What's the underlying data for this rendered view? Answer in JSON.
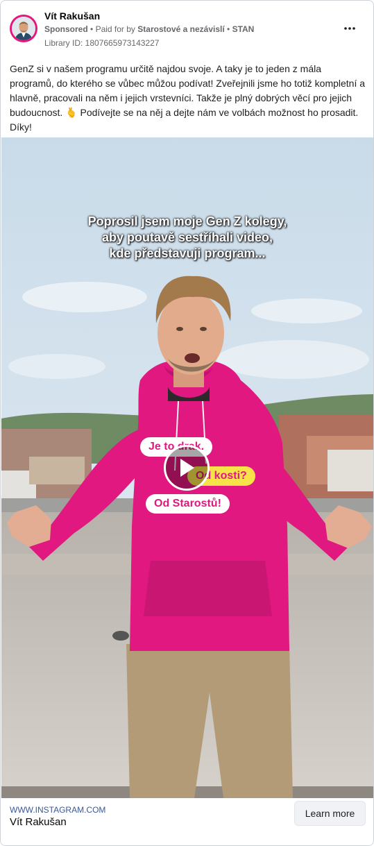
{
  "ad": {
    "advertiser_name": "Vít Rakušan",
    "sponsored_label": "Sponsored",
    "paid_for_prefix": "Paid for by",
    "paid_for_entity": "Starostové a nezávislí",
    "party_abbrev": "STAN",
    "library_id": "Library ID: 1807665973143227",
    "more_options_icon": "more-horizontal-icon",
    "body_text_part1": "GenZ si v našem programu určitě najdou svoje. A taky je to jeden z mála programů, do kterého se vůbec můžou podívat! Zveřejnili jsme ho totiž kompletní a hlavně, pracovali na něm i jejich vrstevníci. Takže je plný dobrých věcí pro jejich budoucnost.",
    "body_emoji": "🫰",
    "body_text_part2": "Podívejte se na něj a dejte nám ve volbách možnost ho prosadit. Díky!"
  },
  "media": {
    "caption_lines": [
      "Poprosil jsem moje Gen Z kolegy,",
      "aby poutavě sestříhali video,",
      "kde představuji program..."
    ],
    "hoodie_texts": [
      "Je to drak.",
      "Od kosti?",
      "Od Starostů!"
    ],
    "play_icon": "play-icon"
  },
  "footer": {
    "link_url": "WWW.INSTAGRAM.COM",
    "link_title": "Vít Rakušan",
    "cta_label": "Learn more"
  },
  "colors": {
    "brand_pink": "#e6157e",
    "link_blue": "#385898",
    "muted_text": "#65676b"
  }
}
